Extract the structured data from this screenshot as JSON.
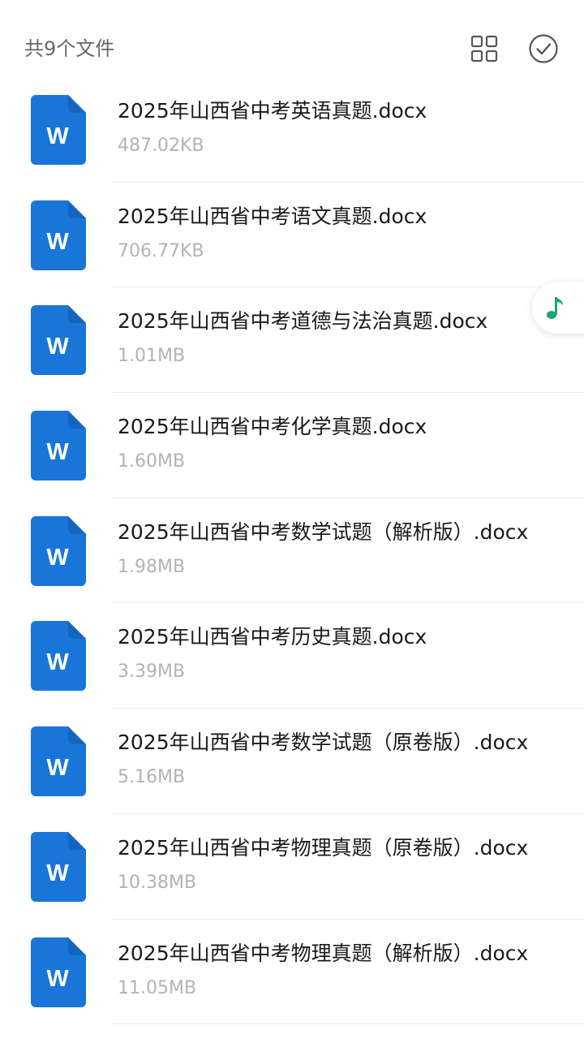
{
  "header": {
    "file_count": "共9个文件",
    "grid_view_icon": "grid-view-icon",
    "select_icon": "check-circle-icon"
  },
  "file_icon": {
    "letter": "W",
    "color": "#1976D8",
    "fold_color": "#1565C0"
  },
  "accent_color": "#1BA672",
  "music_button_icon": "music-note-icon",
  "files": [
    {
      "name": "2025年山西省中考英语真题.docx",
      "size": "487.02KB"
    },
    {
      "name": "2025年山西省中考语文真题.docx",
      "size": "706.77KB"
    },
    {
      "name": "2025年山西省中考道德与法治真题.docx",
      "size": "1.01MB"
    },
    {
      "name": "2025年山西省中考化学真题.docx",
      "size": "1.60MB"
    },
    {
      "name": "2025年山西省中考数学试题（解析版）.docx",
      "size": "1.98MB"
    },
    {
      "name": "2025年山西省中考历史真题.docx",
      "size": "3.39MB"
    },
    {
      "name": "2025年山西省中考数学试题（原卷版）.docx",
      "size": "5.16MB"
    },
    {
      "name": "2025年山西省中考物理真题（原卷版）.docx",
      "size": "10.38MB"
    },
    {
      "name": "2025年山西省中考物理真题（解析版）.docx",
      "size": "11.05MB"
    }
  ]
}
